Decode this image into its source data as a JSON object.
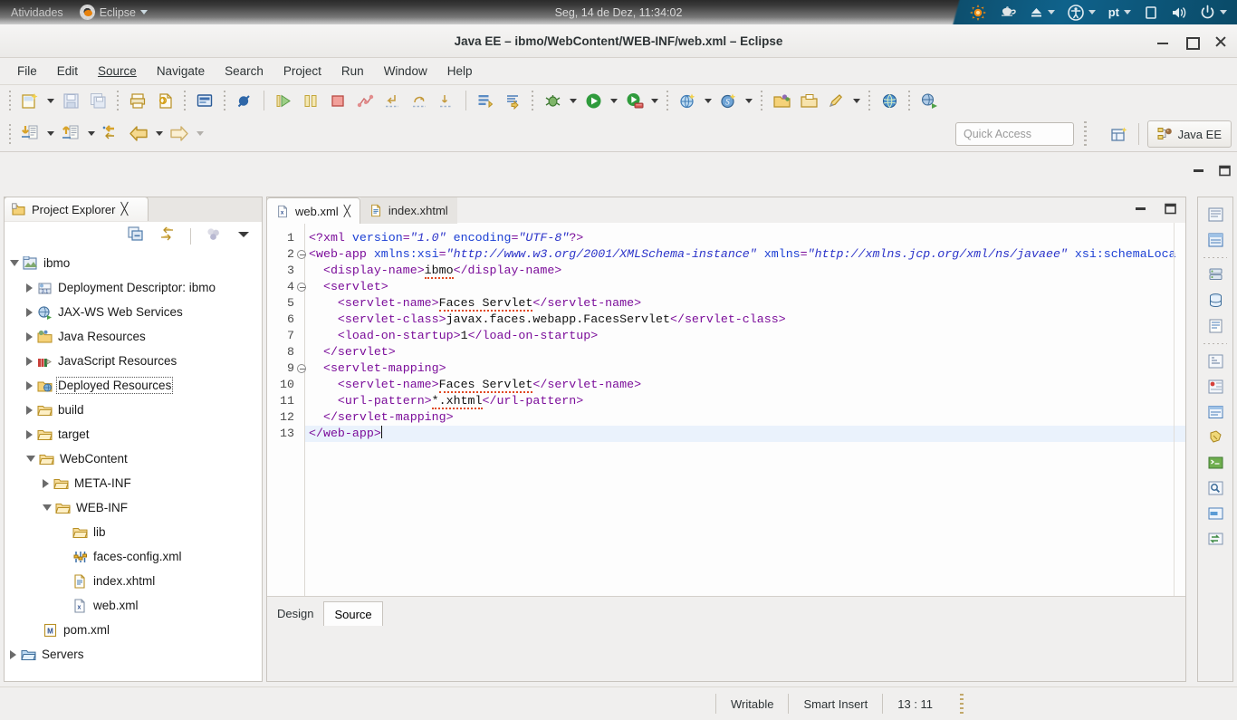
{
  "gnome": {
    "activities": "Atividades",
    "app_menu": "Eclipse",
    "clock": "Seg, 14 de Dez, 11:34:02",
    "indicators": [
      {
        "name": "brightness-icon",
        "label": ""
      },
      {
        "name": "teapot-icon",
        "label": ""
      },
      {
        "name": "eject-icon",
        "label": ""
      },
      {
        "name": "accessibility-icon",
        "label": ""
      },
      {
        "name": "keyboard-layout-indicator",
        "label": "pt"
      },
      {
        "name": "display-icon",
        "label": ""
      },
      {
        "name": "volume-icon",
        "label": ""
      },
      {
        "name": "power-icon",
        "label": ""
      }
    ]
  },
  "window": {
    "title": "Java EE – ibmo/WebContent/WEB-INF/web.xml – Eclipse",
    "buttons": {
      "minimize": "Minimize",
      "maximize": "Maximize",
      "close": "Close"
    }
  },
  "menubar": [
    {
      "label": "File"
    },
    {
      "label": "Edit"
    },
    {
      "label": "Source"
    },
    {
      "label": "Navigate"
    },
    {
      "label": "Search"
    },
    {
      "label": "Project"
    },
    {
      "label": "Run"
    },
    {
      "label": "Window"
    },
    {
      "label": "Help"
    }
  ],
  "toolbar": {
    "quick_access_placeholder": "Quick Access",
    "perspective_label": "Java EE",
    "row1_icons": [
      "new-wizard-icon",
      "new-wizard-dropdown",
      "save-icon",
      "save-all-icon",
      "print-icon",
      "validate-icon",
      "open-task-icon",
      "skip-breakpoints-icon",
      "resume-icon",
      "suspend-icon",
      "terminate-icon",
      "disconnect-icon",
      "step-return-icon",
      "step-over-icon",
      "step-into-icon",
      "new-java-class-icon",
      "new-annotation-icon",
      "debug-icon",
      "debug-dropdown",
      "run-icon",
      "run-dropdown",
      "run-server-icon",
      "run-server-dropdown",
      "new-web-project-icon",
      "new-web-project-dropdown",
      "new-session-bean-icon",
      "new-session-bean-dropdown",
      "open-type-icon",
      "open-task-list-icon",
      "search-icon",
      "search-dropdown",
      "web-browser-icon",
      "new-jaxws-icon"
    ],
    "row2_icons": [
      "previous-annotation-icon",
      "previous-annotation-dropdown",
      "next-annotation-icon",
      "next-annotation-dropdown",
      "last-edit-location-icon",
      "back-icon",
      "back-dropdown",
      "forward-icon",
      "forward-dropdown"
    ]
  },
  "explorer": {
    "title": "Project Explorer",
    "toolbar_icons": [
      "collapse-all-icon",
      "link-with-editor-icon",
      "focus-on-active-task-icon",
      "view-menu-icon"
    ],
    "head_icons": [
      "minimize-icon",
      "maximize-icon"
    ],
    "tree": [
      {
        "label": "ibmo",
        "depth": 0,
        "twisty": "down",
        "icon": "java-project-icon",
        "focused": false
      },
      {
        "label": "Deployment Descriptor: ibmo",
        "depth": 1,
        "twisty": "right",
        "icon": "deployment-descriptor-icon",
        "focused": false
      },
      {
        "label": "JAX-WS Web Services",
        "depth": 1,
        "twisty": "right",
        "icon": "jaxws-icon",
        "focused": false
      },
      {
        "label": "Java Resources",
        "depth": 1,
        "twisty": "right",
        "icon": "java-resources-icon",
        "focused": false
      },
      {
        "label": "JavaScript Resources",
        "depth": 1,
        "twisty": "right",
        "icon": "javascript-resources-icon",
        "focused": false
      },
      {
        "label": "Deployed Resources",
        "depth": 1,
        "twisty": "right",
        "icon": "deployed-resources-icon",
        "focused": true
      },
      {
        "label": "build",
        "depth": 1,
        "twisty": "right",
        "icon": "folder-icon",
        "focused": false
      },
      {
        "label": "target",
        "depth": 1,
        "twisty": "right",
        "icon": "folder-icon",
        "focused": false
      },
      {
        "label": "WebContent",
        "depth": 1,
        "twisty": "down",
        "icon": "folder-icon",
        "focused": false
      },
      {
        "label": "META-INF",
        "depth": 2,
        "twisty": "right",
        "icon": "folder-icon",
        "focused": false
      },
      {
        "label": "WEB-INF",
        "depth": 2,
        "twisty": "down",
        "icon": "folder-icon",
        "focused": false
      },
      {
        "label": "lib",
        "depth": 3,
        "twisty": "none",
        "icon": "folder-icon",
        "focused": false
      },
      {
        "label": "faces-config.xml",
        "depth": 3,
        "twisty": "none",
        "icon": "faces-config-icon",
        "focused": false
      },
      {
        "label": "index.xhtml",
        "depth": 3,
        "twisty": "none",
        "icon": "xhtml-file-icon",
        "focused": false
      },
      {
        "label": "web.xml",
        "depth": 3,
        "twisty": "none",
        "icon": "xml-file-icon",
        "focused": false
      },
      {
        "label": "pom.xml",
        "depth": 2,
        "twisty": "none",
        "icon": "maven-pom-icon",
        "focused": false
      },
      {
        "label": "Servers",
        "depth": 0,
        "twisty": "right",
        "icon": "folder-icon-blue",
        "focused": false
      }
    ]
  },
  "editor": {
    "tabs": [
      {
        "label": "web.xml",
        "icon": "xml-file-icon",
        "active": true,
        "closable": true
      },
      {
        "label": "index.xhtml",
        "icon": "xhtml-file-icon",
        "active": false,
        "closable": false
      }
    ],
    "header_icons": [
      "minimize-icon",
      "maximize-icon"
    ],
    "bottom_tabs": [
      {
        "label": "Design",
        "active": false
      },
      {
        "label": "Source",
        "active": true
      }
    ],
    "current_line": 13,
    "lines": [
      {
        "n": 1,
        "fold": false,
        "tokens": [
          {
            "t": "<?xml ",
            "c": "pi"
          },
          {
            "t": "version",
            "c": "at"
          },
          {
            "t": "=",
            "c": "tg"
          },
          {
            "t": "\"1.0\"",
            "c": "av"
          },
          {
            "t": " ",
            "c": "tx"
          },
          {
            "t": "encoding",
            "c": "at"
          },
          {
            "t": "=",
            "c": "tg"
          },
          {
            "t": "\"UTF-8\"",
            "c": "av"
          },
          {
            "t": "?>",
            "c": "pi"
          }
        ]
      },
      {
        "n": 2,
        "fold": true,
        "tokens": [
          {
            "t": "<web-app ",
            "c": "tg"
          },
          {
            "t": "xmlns:xsi",
            "c": "at"
          },
          {
            "t": "=",
            "c": "tg"
          },
          {
            "t": "\"http://www.w3.org/2001/XMLSchema-instance\"",
            "c": "av"
          },
          {
            "t": " ",
            "c": "tx"
          },
          {
            "t": "xmlns",
            "c": "at"
          },
          {
            "t": "=",
            "c": "tg"
          },
          {
            "t": "\"http://xmlns.jcp.org/xml/ns/javaee\"",
            "c": "av"
          },
          {
            "t": " ",
            "c": "tx"
          },
          {
            "t": "xsi:schemaLoca",
            "c": "at"
          }
        ]
      },
      {
        "n": 3,
        "fold": false,
        "tokens": [
          {
            "t": "  <display-name>",
            "c": "tg"
          },
          {
            "t": "ibmo",
            "c": "tx-sq"
          },
          {
            "t": "</display-name>",
            "c": "tg"
          }
        ]
      },
      {
        "n": 4,
        "fold": true,
        "tokens": [
          {
            "t": "  <servlet>",
            "c": "tg"
          }
        ]
      },
      {
        "n": 5,
        "fold": false,
        "tokens": [
          {
            "t": "    <servlet-name>",
            "c": "tg"
          },
          {
            "t": "Faces Servlet",
            "c": "tx-sq"
          },
          {
            "t": "</servlet-name>",
            "c": "tg"
          }
        ]
      },
      {
        "n": 6,
        "fold": false,
        "tokens": [
          {
            "t": "    <servlet-class>",
            "c": "tg"
          },
          {
            "t": "javax.faces.webapp.FacesServlet",
            "c": "tx"
          },
          {
            "t": "</servlet-class>",
            "c": "tg"
          }
        ]
      },
      {
        "n": 7,
        "fold": false,
        "tokens": [
          {
            "t": "    <load-on-startup>",
            "c": "tg"
          },
          {
            "t": "1",
            "c": "tx"
          },
          {
            "t": "</load-on-startup>",
            "c": "tg"
          }
        ]
      },
      {
        "n": 8,
        "fold": false,
        "tokens": [
          {
            "t": "  </servlet>",
            "c": "tg"
          }
        ]
      },
      {
        "n": 9,
        "fold": true,
        "tokens": [
          {
            "t": "  <servlet-mapping>",
            "c": "tg"
          }
        ]
      },
      {
        "n": 10,
        "fold": false,
        "tokens": [
          {
            "t": "    <servlet-name>",
            "c": "tg"
          },
          {
            "t": "Faces Servlet",
            "c": "tx-sq"
          },
          {
            "t": "</servlet-name>",
            "c": "tg"
          }
        ]
      },
      {
        "n": 11,
        "fold": false,
        "tokens": [
          {
            "t": "    <url-pattern>",
            "c": "tg"
          },
          {
            "t": "*.xhtml",
            "c": "tx-sq"
          },
          {
            "t": "</url-pattern>",
            "c": "tg"
          }
        ]
      },
      {
        "n": 12,
        "fold": false,
        "tokens": [
          {
            "t": "  </servlet-mapping>",
            "c": "tg"
          }
        ]
      },
      {
        "n": 13,
        "fold": false,
        "tokens": [
          {
            "t": "</web-app>",
            "c": "tg"
          }
        ]
      }
    ]
  },
  "fastview": {
    "icons": [
      "markers-view-icon",
      "properties-view-icon",
      "sep",
      "servers-view-icon",
      "data-source-explorer-icon",
      "snippets-view-icon",
      "sep",
      "outline-view-icon",
      "problems-view-icon",
      "task-list-icon",
      "palette-view-icon",
      "console-view-icon",
      "search-view-icon",
      "progress-view-icon",
      "synchronize-view-icon"
    ]
  },
  "statusbar": {
    "writable": "Writable",
    "insert_mode": "Smart Insert",
    "position": "13 : 11"
  }
}
